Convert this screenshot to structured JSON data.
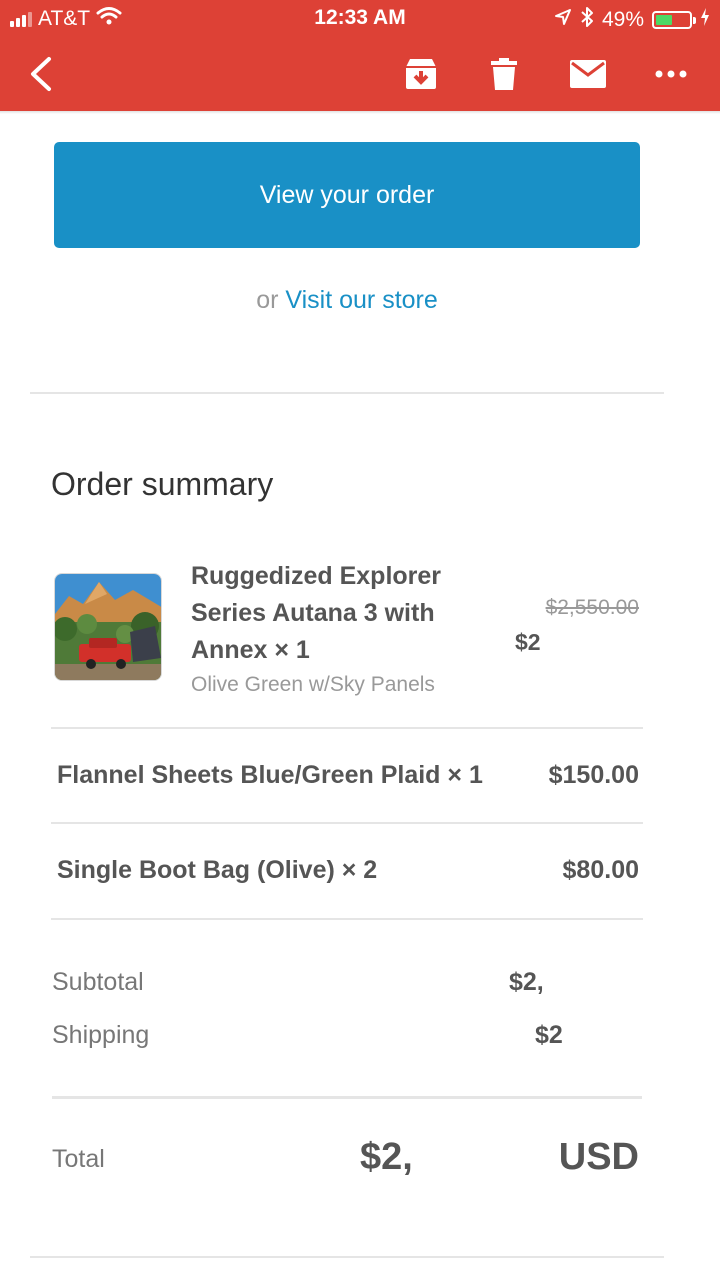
{
  "status_bar": {
    "carrier": "AT&T",
    "time": "12:33 AM",
    "battery": "49%",
    "battery_level": 0.49
  },
  "app_bar": {
    "icons": [
      "back-icon",
      "archive-icon",
      "trash-icon",
      "mail-icon",
      "more-icon"
    ]
  },
  "cta": {
    "view_order": "View your order",
    "or_text": "or",
    "store_link": "Visit our store"
  },
  "order_summary": {
    "title": "Order summary",
    "items": [
      {
        "name": "Ruggedized Explorer Series Autana 3 with Annex × 1",
        "variant": "Olive Green w/Sky Panels",
        "original_price": "$2,550.00",
        "price": "$2"
      },
      {
        "name": "Flannel Sheets Blue/Green Plaid × 1",
        "price": "$150.00"
      },
      {
        "name": "Single Boot Bag (Olive) × 2",
        "price": "$80.00"
      }
    ],
    "subtotal_label": "Subtotal",
    "subtotal_value": "$2,",
    "shipping_label": "Shipping",
    "shipping_value": "$2",
    "total_label": "Total",
    "total_value": "$2,",
    "currency": "USD"
  },
  "colors": {
    "header_red": "#dd4136",
    "accent_blue": "#1990c6",
    "battery_green": "#4cd964"
  }
}
